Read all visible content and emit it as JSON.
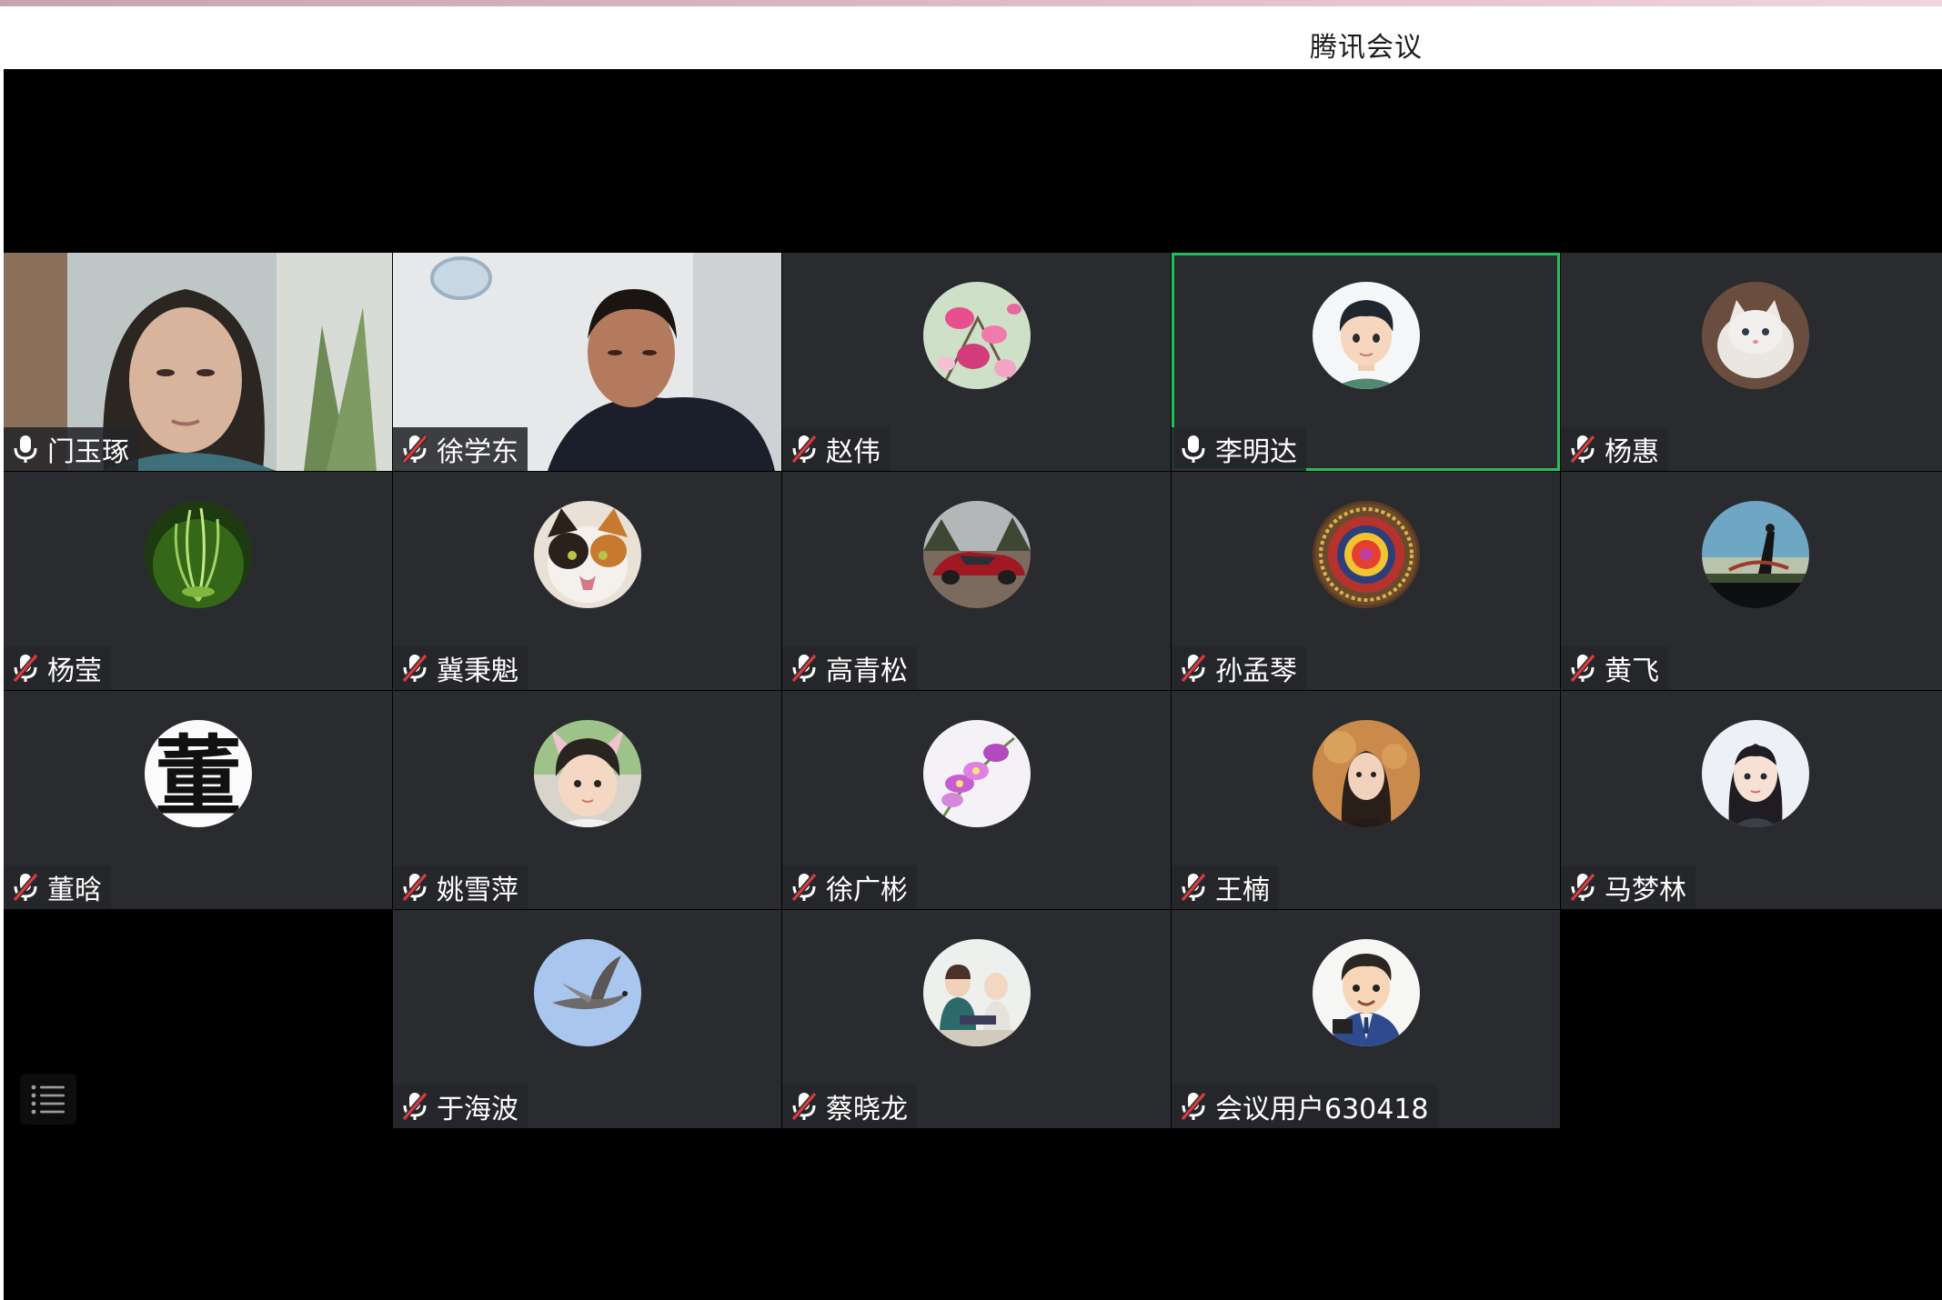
{
  "window": {
    "title": "腾讯会议"
  },
  "colors": {
    "tile_bg": "#292b2e",
    "stage_bg": "#000000",
    "active_speaker_border": "#1fc35c",
    "muted_icon": "#ffffff",
    "muted_slash": "#e4393c"
  },
  "participants": [
    {
      "name": "门玉琢",
      "mic": "on",
      "view": "video",
      "picture": "woman-webcam",
      "active": false
    },
    {
      "name": "徐学东",
      "mic": "muted",
      "view": "video",
      "picture": "man-webcam",
      "active": false
    },
    {
      "name": "赵伟",
      "mic": "muted",
      "view": "avatar",
      "picture": "magnolia-flowers",
      "active": false
    },
    {
      "name": "李明达",
      "mic": "on",
      "view": "avatar",
      "picture": "cartoon-boy",
      "active": true
    },
    {
      "name": "杨惠",
      "mic": "muted",
      "view": "avatar",
      "picture": "white-kitten",
      "active": false
    },
    {
      "name": "杨莹",
      "mic": "muted",
      "view": "avatar",
      "picture": "green-plant",
      "active": false
    },
    {
      "name": "冀秉魁",
      "mic": "muted",
      "view": "avatar",
      "picture": "calico-cat",
      "active": false
    },
    {
      "name": "高青松",
      "mic": "muted",
      "view": "avatar",
      "picture": "red-sports-car",
      "active": false
    },
    {
      "name": "孙孟琴",
      "mic": "muted",
      "view": "avatar",
      "picture": "mandala",
      "active": false
    },
    {
      "name": "黄飞",
      "mic": "muted",
      "view": "avatar",
      "picture": "landscape-figure",
      "active": false
    },
    {
      "name": "董晗",
      "mic": "muted",
      "view": "avatar",
      "picture": "calligraphy-character",
      "glyph": "董",
      "active": false
    },
    {
      "name": "姚雪萍",
      "mic": "muted",
      "view": "avatar",
      "picture": "toddler-bunny-ears",
      "active": false
    },
    {
      "name": "徐广彬",
      "mic": "muted",
      "view": "avatar",
      "picture": "purple-orchid",
      "active": false
    },
    {
      "name": "王楠",
      "mic": "muted",
      "view": "avatar",
      "picture": "woman-portrait",
      "active": false
    },
    {
      "name": "马梦林",
      "mic": "muted",
      "view": "avatar",
      "picture": "cartoon-girl",
      "active": false
    },
    {
      "name": "于海波",
      "mic": "muted",
      "view": "avatar",
      "picture": "flying-pigeon",
      "active": false
    },
    {
      "name": "蔡晓龙",
      "mic": "muted",
      "view": "avatar",
      "picture": "two-children",
      "active": false
    },
    {
      "name": "会议用户630418",
      "mic": "muted",
      "view": "avatar",
      "picture": "cartoon-man-suit",
      "active": false
    }
  ],
  "controls": {
    "layout_button_icon": "list-layout-icon"
  }
}
